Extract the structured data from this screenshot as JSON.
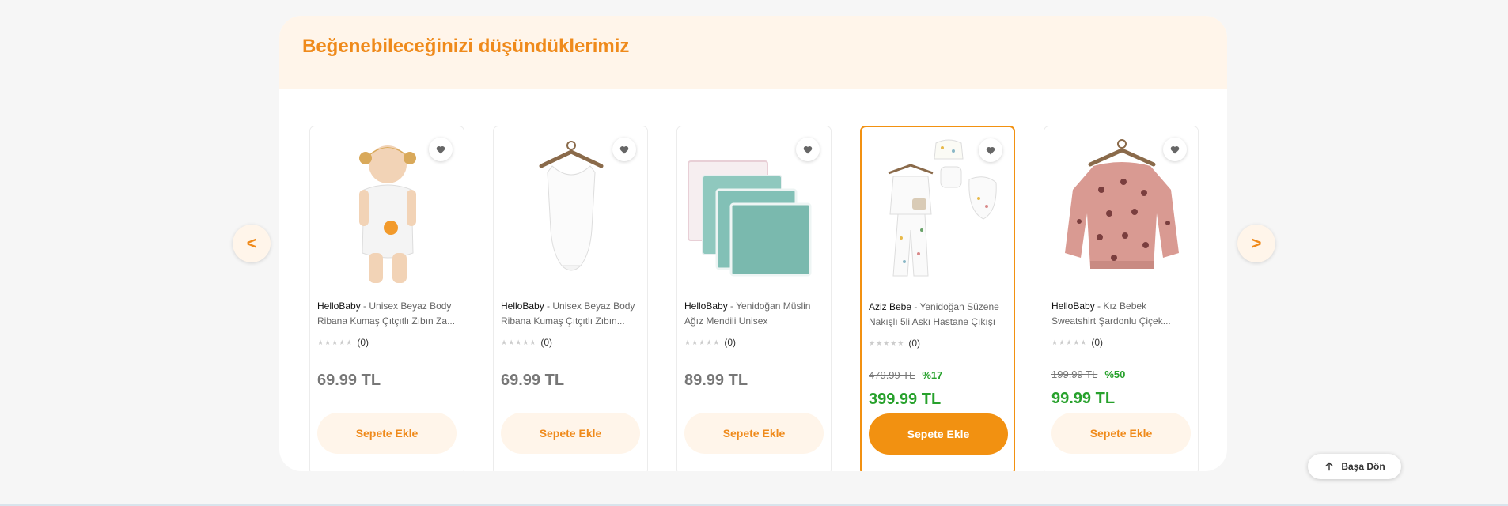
{
  "section": {
    "title": "Beğenebileceğinizi düşündüklerimiz"
  },
  "nav": {
    "prev": "<",
    "next": ">"
  },
  "back_to_top": {
    "label": "Başa Dön",
    "icon": "arrow-up-icon"
  },
  "colors": {
    "accent": "#ef8a1b",
    "sale_green": "#27a12c",
    "soft_bg": "#fff5ea"
  },
  "products": [
    {
      "brand": "HelloBaby",
      "separator": " - ",
      "name": "Unisex Beyaz Body Ribana Kumaş Çıtçıtlı Zıbın Za...",
      "rating_count": "(0)",
      "price": "69.99 TL",
      "add_label": "Sepete Ekle"
    },
    {
      "brand": "HelloBaby",
      "separator": " - ",
      "name": "Unisex Beyaz Body Ribana Kumaş Çıtçıtlı Zıbın...",
      "rating_count": "(0)",
      "price": "69.99 TL",
      "add_label": "Sepete Ekle"
    },
    {
      "brand": "HelloBaby",
      "separator": " - ",
      "name": "Yenidoğan Müslin Ağız Mendili Unisex",
      "rating_count": "(0)",
      "price": "89.99 TL",
      "add_label": "Sepete Ekle"
    },
    {
      "brand": "Aziz Bebe",
      "separator": " - ",
      "name": "Yenidoğan Süzene Nakışlı 5li Askı Hastane Çıkışı",
      "rating_count": "(0)",
      "old_price": "479.99 TL",
      "discount": "%17",
      "price": "399.99 TL",
      "add_label": "Sepete Ekle"
    },
    {
      "brand": "HelloBaby",
      "separator": " - ",
      "name": "Kız Bebek Sweatshirt Şardonlu Çiçek...",
      "rating_count": "(0)",
      "old_price": "199.99 TL",
      "discount": "%50",
      "price": "99.99 TL",
      "add_label": "Sepete Ekle"
    }
  ]
}
